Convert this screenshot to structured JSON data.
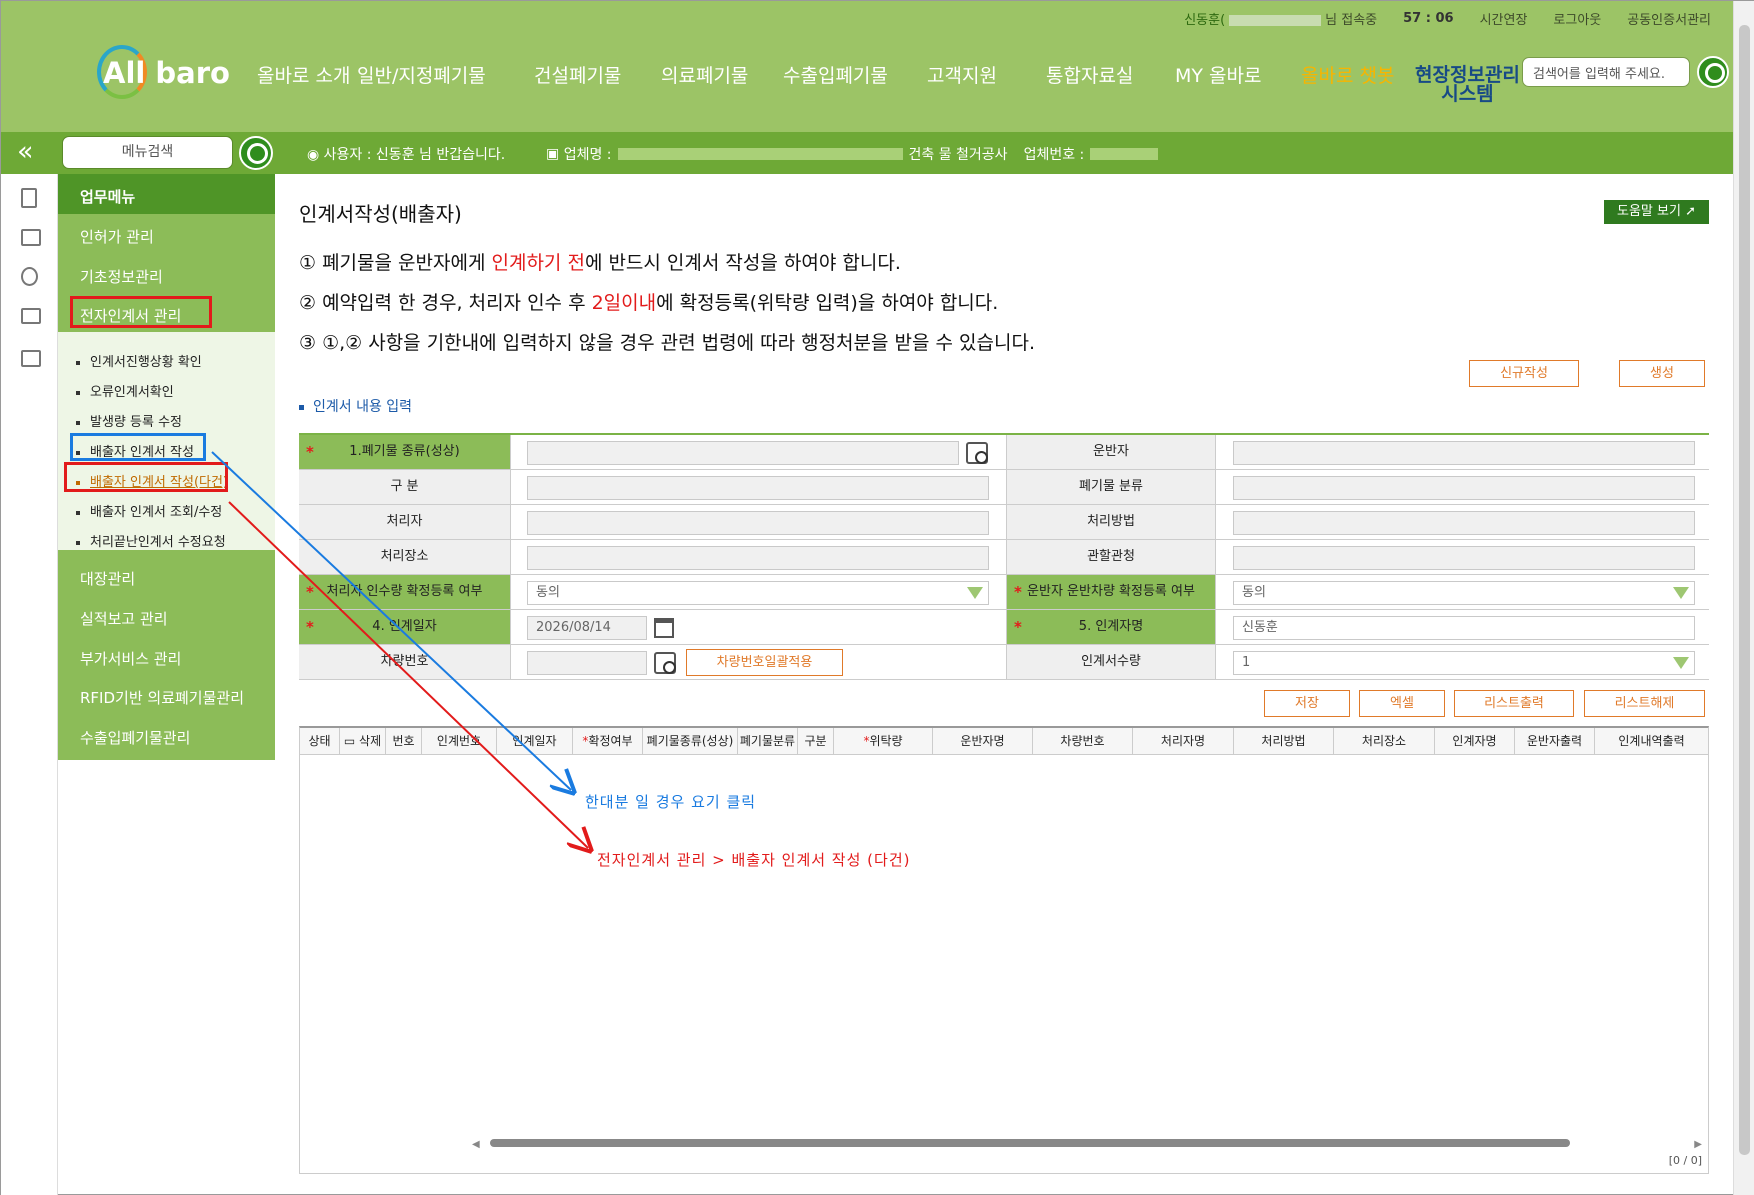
{
  "util": {
    "user": "신동훈(",
    "status": "님 접속중",
    "timer": "57 : 06",
    "extend": "시간연장",
    "logout": "로그아웃",
    "cert": "공동인증서관리"
  },
  "logo": {
    "text": "All baro"
  },
  "gnb": [
    "올바로 소개",
    "일반/지정폐기물",
    "건설폐기물",
    "의료폐기물",
    "수출입폐기물",
    "고객지원",
    "통합자료실",
    "MY 올바로"
  ],
  "gnb_chat": "올바로 챗봇",
  "gnb_site": "현장정보관리\n시스템",
  "gnb_site_line1": "현장정보관리",
  "gnb_site_line2": "시스템",
  "search": {
    "placeholder": "검색어를 입력해 주세요."
  },
  "navbar": {
    "menu_search": "메뉴검색",
    "user": "사용자 : 신동훈 님 반갑습니다.",
    "company_label": "업체명 :",
    "company_suffix": "건축 물 철거공사",
    "bizno_label": "업체번호 :"
  },
  "lnb": {
    "header": "업무메뉴",
    "items": [
      "인허가 관리",
      "기초정보관리",
      "전자인계서 관리"
    ],
    "sub": [
      "인계서진행상황 확인",
      "오류인계서확인",
      "발생량 등록 수정",
      "배출자 인계서 작성",
      "배출자 인계서 작성(다건)",
      "배출자 인계서 조회/수정",
      "처리끝난인계서 수정요청"
    ],
    "items2": [
      "대장관리",
      "실적보고 관리",
      "부가서비스 관리",
      "RFID기반 의료폐기물관리",
      "수출입폐기물관리"
    ]
  },
  "page": {
    "title": "인계서작성(배출자)",
    "help": "도움말 보기",
    "notice1_a": "① 폐기물을 운반자에게 ",
    "notice1_red": "인계하기 전",
    "notice1_b": "에 반드시 인계서 작성을 하여야 합니다.",
    "notice2_a": "② 예약입력 한 경우, 처리자 인수 후 ",
    "notice2_red": "2일이내",
    "notice2_b": "에 확정등록(위탁량 입력)을 하여야 합니다.",
    "notice3": "③ ①,② 사항을 기한내에 입력하지 않을 경우 관련 법령에 따라 행정처분을 받을 수 있습니다.",
    "btn_new": "신규작성",
    "btn_create": "생성",
    "section": "인계서 내용 입력"
  },
  "form": {
    "waste_type": "1.폐기물 종류(성상)",
    "transporter": "운반자",
    "category": "구 분",
    "waste_class": "폐기물 분류",
    "processor": "처리자",
    "method": "처리방법",
    "place": "처리장소",
    "office": "관할관청",
    "proc_confirm": "처리자 인수량 확정등록 여부",
    "proc_confirm_val": "동의",
    "trans_confirm": "운반자 운반차량 확정등록 여부",
    "trans_confirm_val": "동의",
    "date_label": "4. 인계일자",
    "date_val": "2026/08/14",
    "name_label": "5. 인계자명",
    "name_val": "신동훈",
    "vehicle": "차량번호",
    "vehicle_btn": "차량번호일괄적용",
    "qty_label": "인계서수량",
    "qty_val": "1"
  },
  "actions": [
    "저장",
    "엑셀",
    "리스트출력",
    "리스트해제"
  ],
  "grid": {
    "headers": [
      "상태",
      "삭제",
      "번호",
      "인계번호",
      "인계일자",
      "확정여부",
      "폐기물종류(성상)",
      "폐기물분류",
      "구분",
      "위탁량",
      "운반자명",
      "차량번호",
      "처리자명",
      "처리방법",
      "처리장소",
      "인계자명",
      "운반자출력",
      "인계내역출력"
    ],
    "pager": "[0 / 0]"
  },
  "annotations": {
    "blue": "한대분 일 경우 요기 클릭",
    "red": "전자인계서 관리 > 배출자 인계서 작성 (다건)",
    "blue_color": "#1a7be0",
    "red_color": "#e21b1b"
  },
  "colors": {
    "brand": "#9cc466",
    "nav": "#6ea936",
    "lnb_head": "#4f9527",
    "accent_orange": "#e07a2a"
  }
}
